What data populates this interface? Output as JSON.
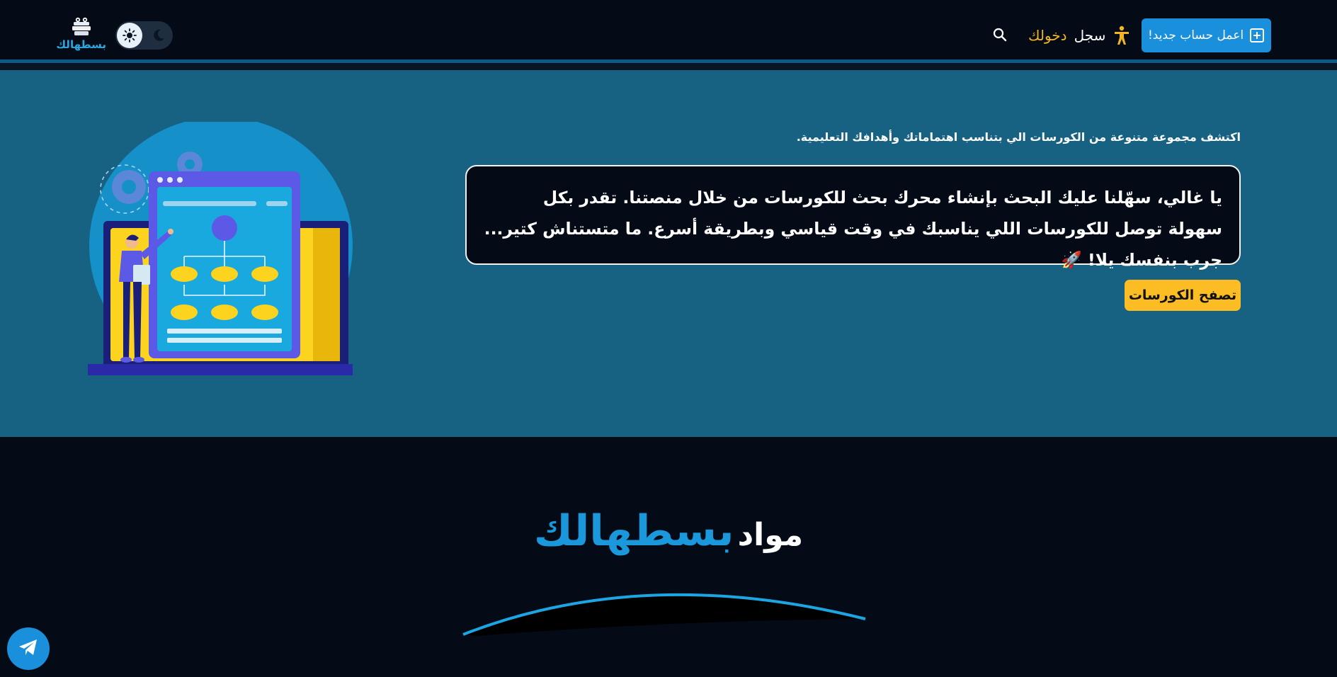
{
  "header": {
    "signup_label": "اعمل حساب جديد!",
    "login_label": "سجل",
    "login_highlight": "دخولك",
    "logo_text": "بسطهالك",
    "theme_toggle": "light"
  },
  "hero": {
    "subtitle": "اكتشف مجموعة متنوعة من الكورسات الي بتناسب اهتماماتك وأهدافك التعليمية.",
    "card_text": "يا غالي، سهّلنا عليك البحث بإنشاء محرك بحث للكورسات من خلال منصتنا. تقدر بكل سهولة توصل للكورسات اللي يناسبك في وقت قياسي وبطريقة أسرع. ما متستناش كتير... جرب بنفسك يلا! 🚀",
    "browse_label": "تصفح الكورسات"
  },
  "section": {
    "title_part1": "مواد",
    "title_part2": "بسطهالك"
  },
  "colors": {
    "background": "#040b17",
    "hero_bg": "#176282",
    "primary": "#1a8fdb",
    "accent": "#fbbd23"
  },
  "icons": {
    "signup": "plus-square-icon",
    "login": "accessibility-person-icon",
    "search": "search-icon",
    "sun": "sun-icon",
    "moon": "moon-icon",
    "telegram": "telegram-icon"
  }
}
